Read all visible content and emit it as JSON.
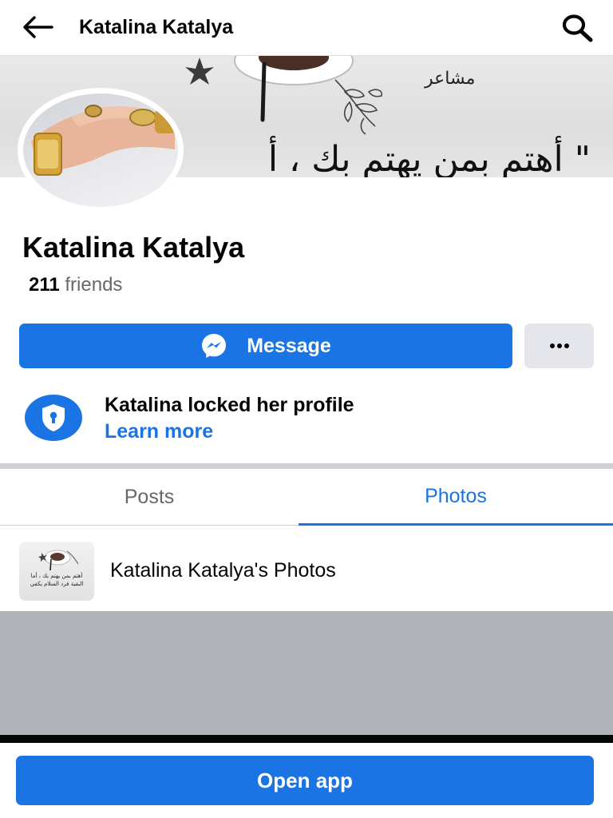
{
  "header": {
    "title": "Katalina Katalya",
    "back_icon": "arrow-left-icon",
    "search_icon": "search-icon"
  },
  "cover": {
    "text_top": "مشاعر",
    "text_main": "\" أهتم بمن يهتم بك ، أ"
  },
  "profile": {
    "name": "Katalina Katalya",
    "friends_count": "211",
    "friends_label": "friends"
  },
  "actions": {
    "message_label": "Message",
    "message_icon": "messenger-icon",
    "more_label": "···"
  },
  "locked": {
    "title": "Katalina locked her profile",
    "link": "Learn more",
    "icon": "shield-lock-icon"
  },
  "tabs": [
    {
      "label": "Posts",
      "active": false
    },
    {
      "label": "Photos",
      "active": true
    }
  ],
  "album": {
    "label": "Katalina Katalya's Photos",
    "thumb_text": "أهتم بمن يهتم بك ، أما البقية فرد السلام يكفي"
  },
  "footer": {
    "open_app_label": "Open app"
  },
  "colors": {
    "accent": "#1b74e4",
    "text": "#050505",
    "secondary_text": "#65676b",
    "gray_area": "#b0b3b8"
  }
}
